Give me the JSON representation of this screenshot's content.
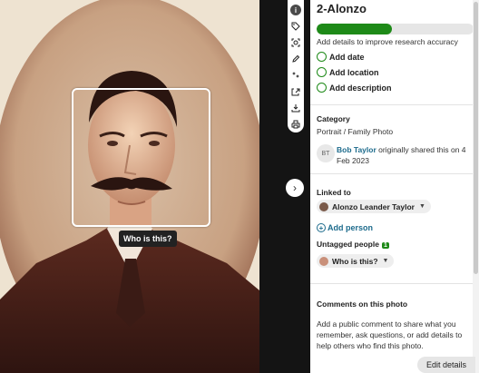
{
  "viewer": {
    "face_tag_label": "Who is this?",
    "toolbar": [
      {
        "icon": "info-icon",
        "label": "i"
      },
      {
        "icon": "tag-icon"
      },
      {
        "icon": "face-detect-icon"
      },
      {
        "icon": "pencil-icon"
      },
      {
        "icon": "enhance-icon"
      },
      {
        "icon": "share-icon"
      },
      {
        "icon": "download-icon"
      },
      {
        "icon": "print-icon"
      }
    ],
    "next_icon": "›"
  },
  "panel": {
    "title": "2-Alonzo",
    "progress_fraction": 0.48,
    "progress_hint": "Add details to improve research accuracy",
    "checklist": [
      "Add date",
      "Add location",
      "Add description"
    ],
    "category_label": "Category",
    "category_value": "Portrait / Family Photo",
    "sharer_initials": "BT",
    "sharer_name": "Bob Taylor",
    "shared_text": " originally shared this on 4 Feb 2023",
    "linked_label": "Linked to",
    "linked_person": "Alonzo Leander Taylor",
    "add_person": "Add person",
    "untagged_label": "Untagged people",
    "untagged_count": "1",
    "untagged_chip": "Who is this?",
    "comments_label": "Comments on this photo",
    "comments_text": "Add a public comment to share what you remember, ask questions, or add details to help others who find this photo.",
    "edit_button": "Edit details"
  },
  "colors": {
    "accent_green": "#1e8a18",
    "link_blue": "#1d6b8c"
  }
}
